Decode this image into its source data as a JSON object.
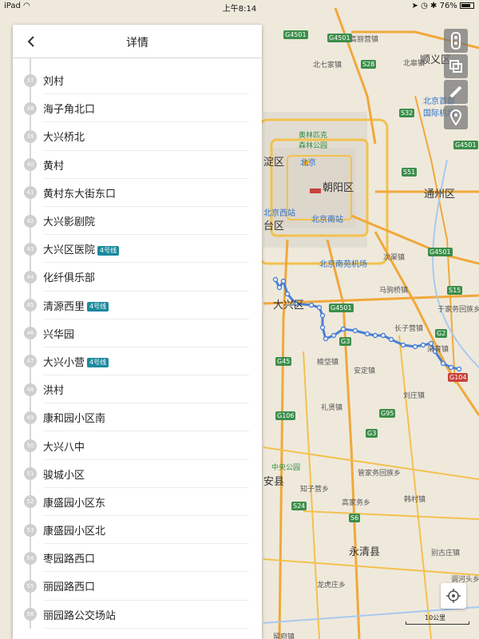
{
  "status_bar": {
    "device": "iPad",
    "time": "上午8:14",
    "battery": "76%"
  },
  "panel": {
    "title": "详情",
    "stops": [
      {
        "num": "37",
        "name": "刘村",
        "line": ""
      },
      {
        "num": "38",
        "name": "海子角北口",
        "line": ""
      },
      {
        "num": "39",
        "name": "大兴桥北",
        "line": ""
      },
      {
        "num": "40",
        "name": "黄村",
        "line": ""
      },
      {
        "num": "41",
        "name": "黄村东大街东口",
        "line": ""
      },
      {
        "num": "42",
        "name": "大兴影剧院",
        "line": ""
      },
      {
        "num": "43",
        "name": "大兴区医院",
        "line": "4号线"
      },
      {
        "num": "44",
        "name": "化纤俱乐部",
        "line": ""
      },
      {
        "num": "45",
        "name": "清源西里",
        "line": "4号线"
      },
      {
        "num": "46",
        "name": "兴华园",
        "line": ""
      },
      {
        "num": "47",
        "name": "大兴小营",
        "line": "4号线"
      },
      {
        "num": "48",
        "name": "洪村",
        "line": ""
      },
      {
        "num": "49",
        "name": "康和园小区南",
        "line": ""
      },
      {
        "num": "50",
        "name": "大兴八中",
        "line": ""
      },
      {
        "num": "51",
        "name": "骏城小区",
        "line": ""
      },
      {
        "num": "52",
        "name": "康盛园小区东",
        "line": ""
      },
      {
        "num": "53",
        "name": "康盛园小区北",
        "line": ""
      },
      {
        "num": "54",
        "name": "枣园路西口",
        "line": ""
      },
      {
        "num": "55",
        "name": "丽园路西口",
        "line": ""
      },
      {
        "num": "56",
        "name": "丽园路公交场站",
        "line": ""
      }
    ]
  },
  "map": {
    "labels": {
      "shunyi": "顺义区",
      "haidian": "淀区",
      "chaoyang": "朝阳区",
      "tongzhou": "通州区",
      "fengtai": "台区",
      "daxing": "大兴区",
      "yongqing": "永清县",
      "guan": "安县",
      "olympic": "奥林匹克森林公园",
      "beijing_west": "北京西站",
      "beijing_south": "北京南站",
      "nanyuan": "北京南苑机场",
      "capital_airport": "北京首都国际机场",
      "beijing_dot": "北京",
      "beiqijia": "北七家镇",
      "gaoliying": "高丽营镇",
      "beigezhuang": "北皋镇",
      "majuqiao": "马驹桥镇",
      "ciqu": "次渠镇",
      "changzi": "长子营镇",
      "anding": "安定镇",
      "caiyu": "采育镇",
      "yufa": "榆垈镇",
      "lixian": "礼贤镇",
      "bieguzhuang": "别古庄镇",
      "hanzhuang": "韩村镇",
      "liuli": "刘庄镇",
      "zhizi": "知子营乡",
      "central_park": "中央公园",
      "yujiawu": "于家务回族乡",
      "dongfeng": "东风乡",
      "beizang": "北臧村",
      "liucun": "柳泉镇",
      "pangezhuang": "庞各庄镇",
      "shachuan": "沙垡乡",
      "bixiang": "毕各庄乡",
      "jiushiwu": "旧州镇",
      "hanzhen": "韩村",
      "guanxiang": "管家务回族乡",
      "gu_an_hu": "高家务乡",
      "dongzhao": "东召乡",
      "longhu": "龙虎庄乡",
      "liufang": "留府镇",
      "tiaohe": "调河头乡",
      "houyi": "后奕镇",
      "liujie": "里澜城镇",
      "maliu": "马庄镇",
      "beijingxi_mark": "北京",
      "xiangheyuan": "香河园"
    },
    "shields": {
      "g4501a": "G4501",
      "g4501b": "G4501",
      "g4501c": "G4501",
      "g4501d": "G4501",
      "g4501e": "G4501",
      "s28": "S28",
      "s32": "S32",
      "s51": "S51",
      "s15": "S15",
      "g45": "G45",
      "g3": "G3",
      "g2": "G2",
      "g1": "G1",
      "g106": "G106",
      "g95": "G95",
      "g3b": "G3",
      "s24": "S24",
      "s6": "S6",
      "g104": "G104",
      "x054": "X054",
      "s3": "S3"
    },
    "scale": "10公里",
    "route_color": "#4a7fd4"
  }
}
